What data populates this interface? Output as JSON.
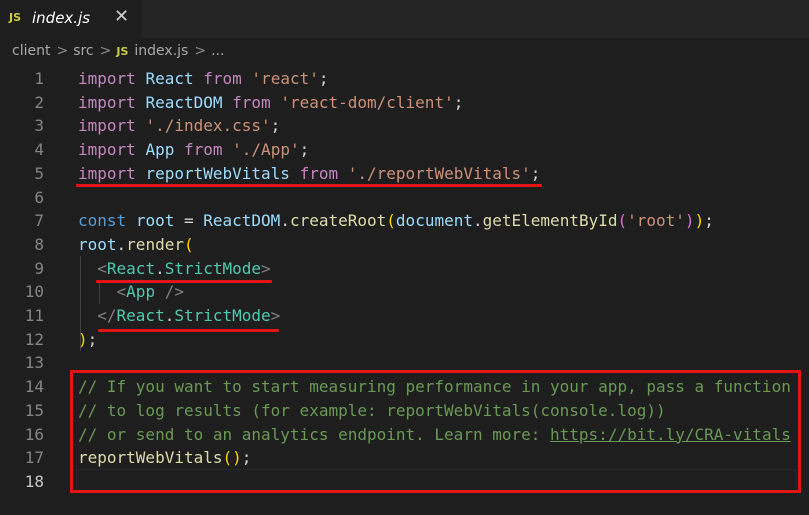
{
  "tab": {
    "icon_label": "JS",
    "filename": "index.js",
    "close_glyph": "✕"
  },
  "breadcrumb": {
    "parts": [
      "client",
      "src",
      "index.js",
      "..."
    ],
    "icon_label": "JS"
  },
  "lines": [
    {
      "n": "1",
      "tokens": [
        [
          "kw",
          "import"
        ],
        [
          "txt",
          " "
        ],
        [
          "id",
          "React"
        ],
        [
          "txt",
          " "
        ],
        [
          "kw",
          "from"
        ],
        [
          "txt",
          " "
        ],
        [
          "str",
          "'react'"
        ],
        [
          "txt",
          ";"
        ]
      ]
    },
    {
      "n": "2",
      "tokens": [
        [
          "kw",
          "import"
        ],
        [
          "txt",
          " "
        ],
        [
          "id",
          "ReactDOM"
        ],
        [
          "txt",
          " "
        ],
        [
          "kw",
          "from"
        ],
        [
          "txt",
          " "
        ],
        [
          "str",
          "'react-dom/client'"
        ],
        [
          "txt",
          ";"
        ]
      ]
    },
    {
      "n": "3",
      "tokens": [
        [
          "kw",
          "import"
        ],
        [
          "txt",
          " "
        ],
        [
          "str",
          "'./index.css'"
        ],
        [
          "txt",
          ";"
        ]
      ]
    },
    {
      "n": "4",
      "tokens": [
        [
          "kw",
          "import"
        ],
        [
          "txt",
          " "
        ],
        [
          "id",
          "App"
        ],
        [
          "txt",
          " "
        ],
        [
          "kw",
          "from"
        ],
        [
          "txt",
          " "
        ],
        [
          "str",
          "'./App'"
        ],
        [
          "txt",
          ";"
        ]
      ]
    },
    {
      "n": "5",
      "tokens": [
        [
          "kw",
          "import"
        ],
        [
          "txt",
          " "
        ],
        [
          "id",
          "reportWebVitals"
        ],
        [
          "txt",
          " "
        ],
        [
          "kw",
          "from"
        ],
        [
          "txt",
          " "
        ],
        [
          "str",
          "'./reportWebVitals'"
        ],
        [
          "txt",
          ";"
        ]
      ]
    },
    {
      "n": "6",
      "tokens": []
    },
    {
      "n": "7",
      "tokens": [
        [
          "ctrl",
          "const"
        ],
        [
          "txt",
          " "
        ],
        [
          "id",
          "root"
        ],
        [
          "txt",
          " = "
        ],
        [
          "id",
          "ReactDOM"
        ],
        [
          "txt",
          "."
        ],
        [
          "fn",
          "createRoot"
        ],
        [
          "br1",
          "("
        ],
        [
          "id",
          "document"
        ],
        [
          "txt",
          "."
        ],
        [
          "fn",
          "getElementById"
        ],
        [
          "br2",
          "("
        ],
        [
          "str",
          "'root'"
        ],
        [
          "br2",
          ")"
        ],
        [
          "br1",
          ")"
        ],
        [
          "txt",
          ";"
        ]
      ]
    },
    {
      "n": "8",
      "tokens": [
        [
          "id",
          "root"
        ],
        [
          "txt",
          "."
        ],
        [
          "fn",
          "render"
        ],
        [
          "br1",
          "("
        ]
      ]
    },
    {
      "n": "9",
      "tokens": [
        [
          "txt",
          "  "
        ],
        [
          "tag",
          "<"
        ],
        [
          "cls",
          "React"
        ],
        [
          "txt",
          "."
        ],
        [
          "cls",
          "StrictMode"
        ],
        [
          "tag",
          ">"
        ]
      ]
    },
    {
      "n": "10",
      "tokens": [
        [
          "txt",
          "    "
        ],
        [
          "tag",
          "<"
        ],
        [
          "cls",
          "App"
        ],
        [
          "txt",
          " "
        ],
        [
          "tag",
          "/>"
        ]
      ]
    },
    {
      "n": "11",
      "tokens": [
        [
          "txt",
          "  "
        ],
        [
          "tag",
          "</"
        ],
        [
          "cls",
          "React"
        ],
        [
          "txt",
          "."
        ],
        [
          "cls",
          "StrictMode"
        ],
        [
          "tag",
          ">"
        ]
      ]
    },
    {
      "n": "12",
      "tokens": [
        [
          "br1",
          ")"
        ],
        [
          "txt",
          ";"
        ]
      ]
    },
    {
      "n": "13",
      "tokens": []
    },
    {
      "n": "14",
      "tokens": [
        [
          "comm",
          "// If you want to start measuring performance in your app, pass a function"
        ]
      ]
    },
    {
      "n": "15",
      "tokens": [
        [
          "comm",
          "// to log results (for example: reportWebVitals(console.log))"
        ]
      ]
    },
    {
      "n": "16",
      "tokens": [
        [
          "comm",
          "// or send to an analytics endpoint. Learn more: "
        ],
        [
          "link",
          "https://bit.ly/CRA-vitals"
        ]
      ]
    },
    {
      "n": "17",
      "tokens": [
        [
          "fn",
          "reportWebVitals"
        ],
        [
          "br1",
          "()"
        ],
        [
          "txt",
          ";"
        ]
      ]
    },
    {
      "n": "18",
      "tokens": []
    }
  ],
  "current_line": "18",
  "colors": {
    "keyword": "#c586c0",
    "variable": "#9cdcfe",
    "component": "#4ec9b0",
    "string": "#ce9178",
    "function": "#dcdcaa",
    "comment": "#6a9955",
    "annotation_red": "#e51414",
    "background": "#1e1e1e"
  }
}
